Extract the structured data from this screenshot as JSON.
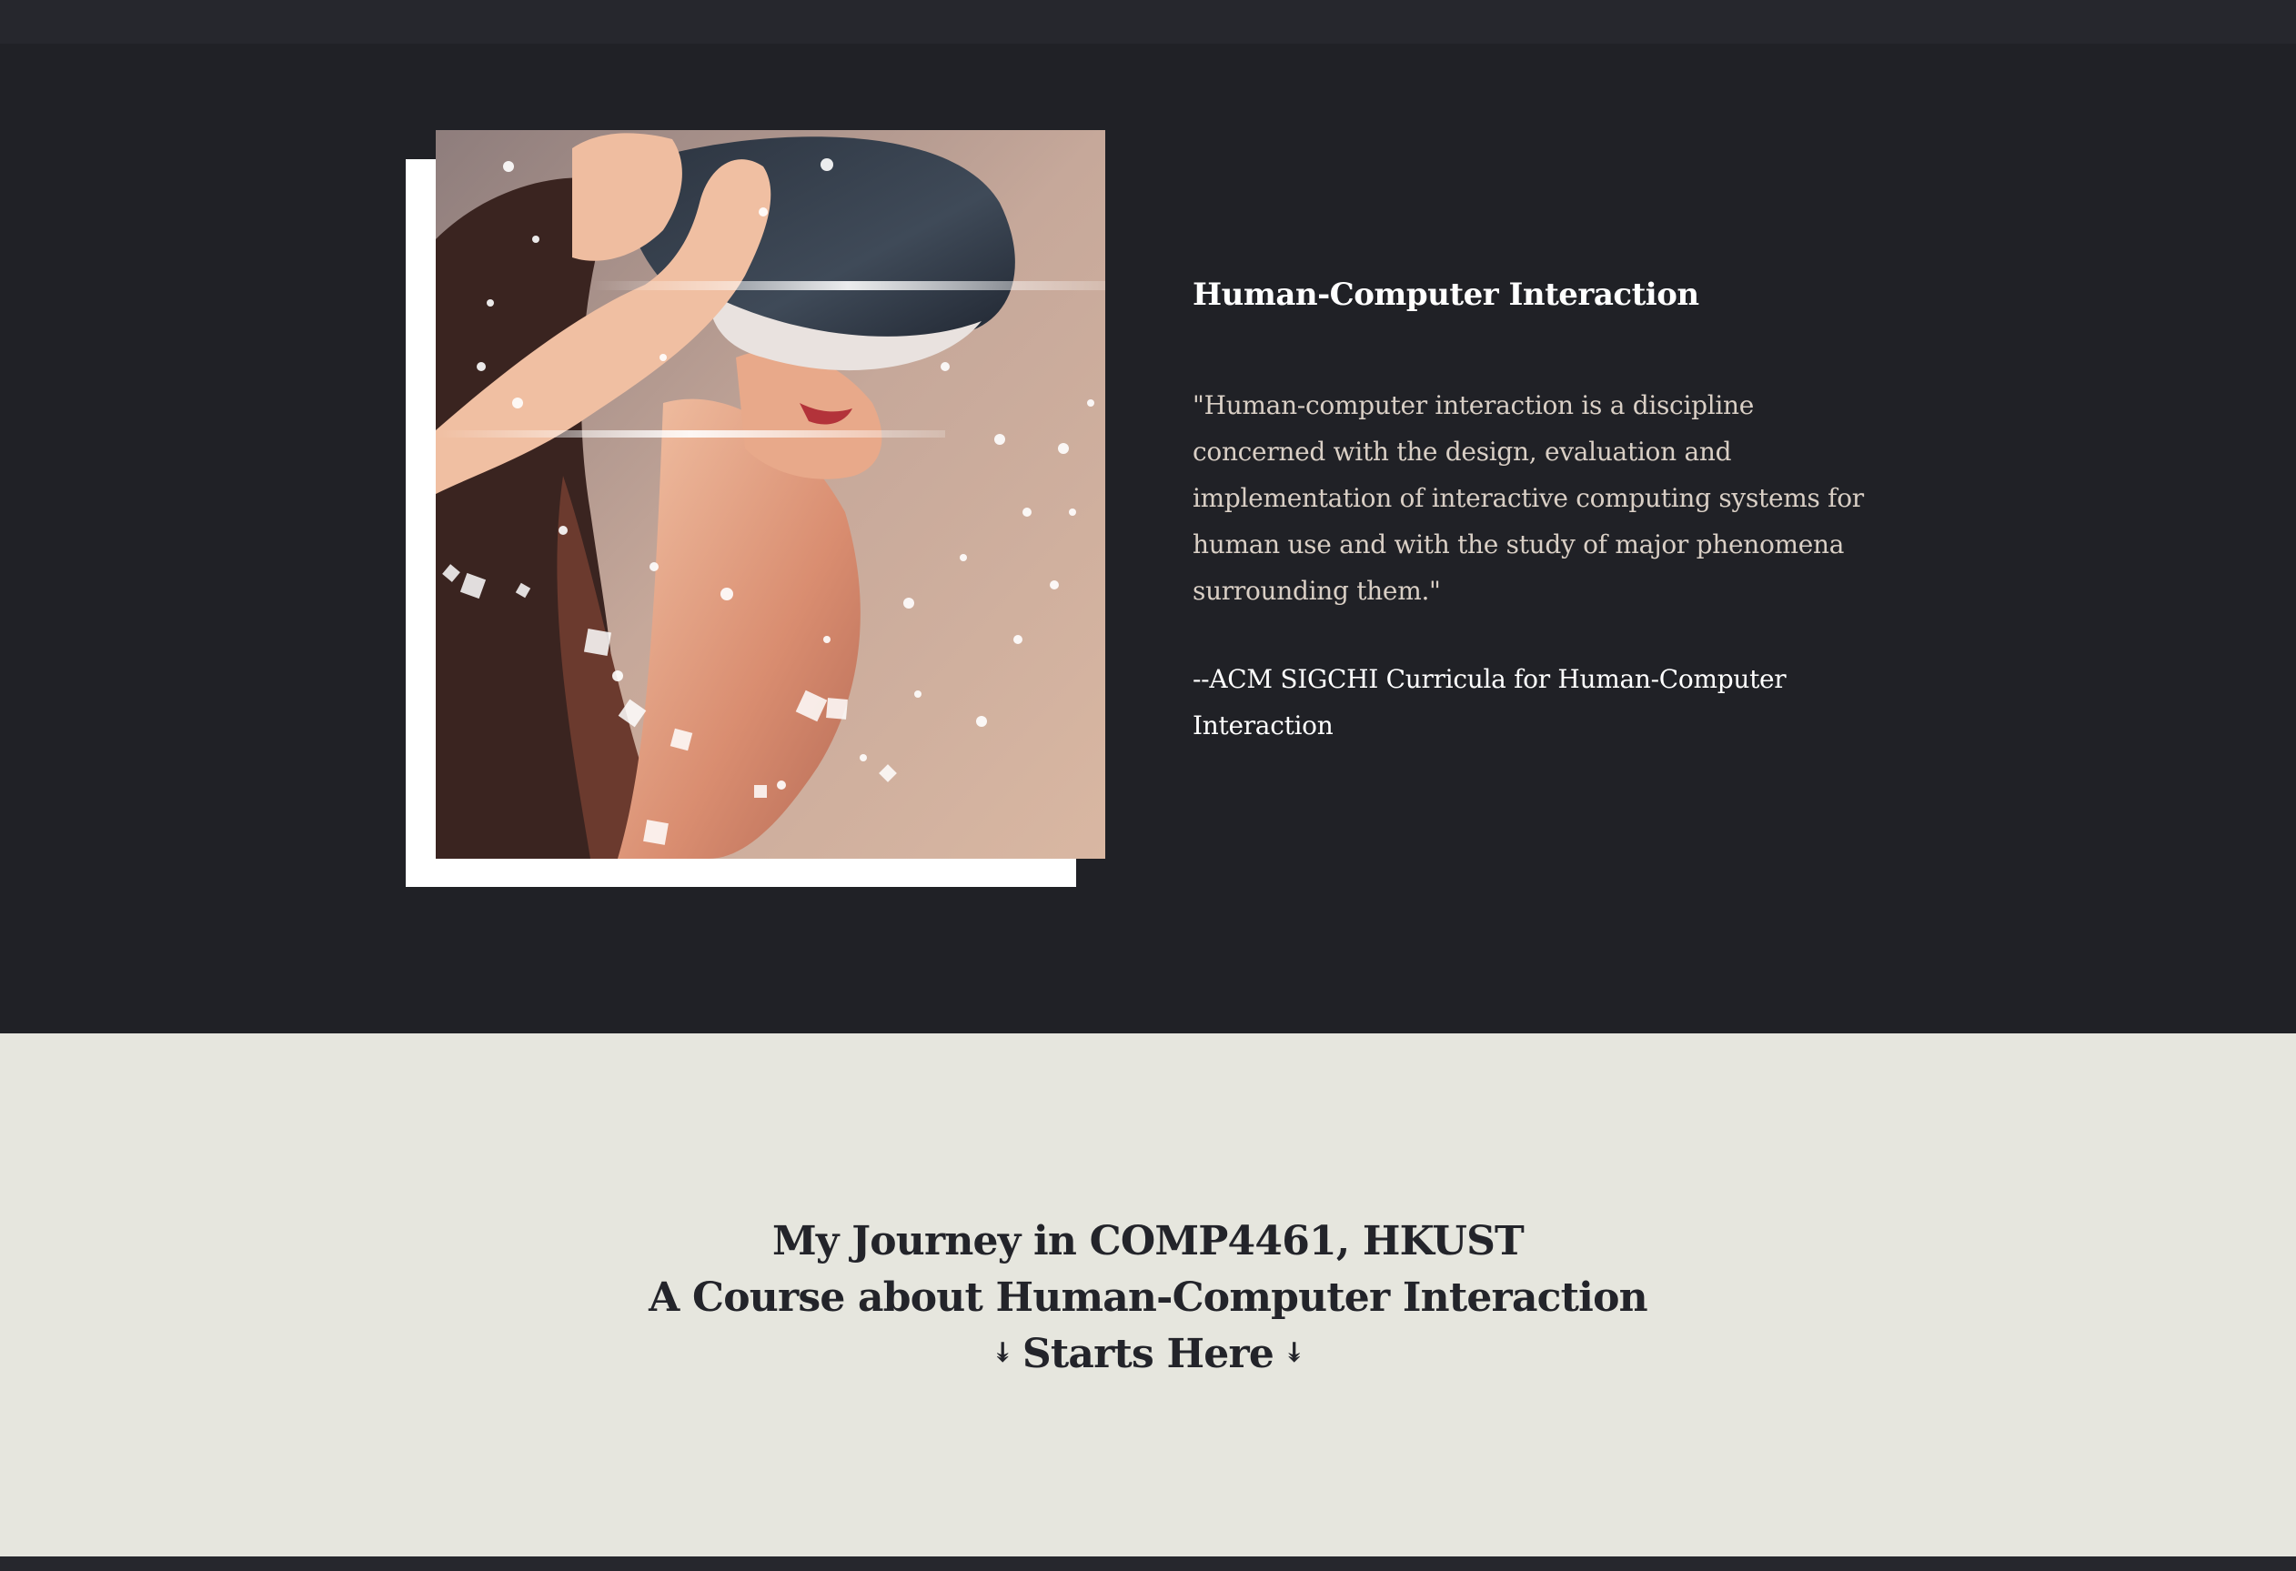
{
  "hci": {
    "title": "Human-Computer Interaction",
    "quote": "\"Human-computer interaction is a discipline concerned with the design, evaluation and implementation of interactive computing systems for human use and with the study of major phenomena surrounding them.\"",
    "source": "--ACM SIGCHI Curricula for Human-Computer Interaction",
    "image_icon": "vr-headset-woman-photo"
  },
  "journey": {
    "line1": "My Journey in COMP4461, HKUST",
    "line2": "A Course about Human-Computer Interaction",
    "line3": "Starts Here",
    "arrow_left": "↡",
    "arrow_right": "↡"
  },
  "colors": {
    "dark_bg": "#202126",
    "bar_bg": "#26272d",
    "light_bg": "#e6e6de",
    "quote_text": "#d9cfc5",
    "heading_dark": "#23242a"
  }
}
